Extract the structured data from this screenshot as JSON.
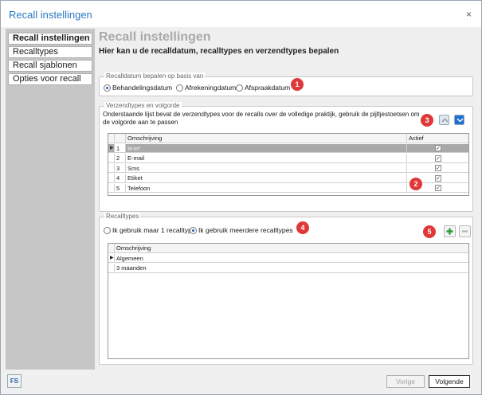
{
  "window": {
    "title": "Recall instellingen",
    "close_glyph": "×"
  },
  "sidebar": {
    "items": [
      {
        "label": "Recall instellingen"
      },
      {
        "label": "Recalltypes"
      },
      {
        "label": "Recall sjablonen"
      },
      {
        "label": "Opties voor recall"
      }
    ]
  },
  "main": {
    "heading": "Recall instellingen",
    "subheading": "Hier kan u de recalldatum, recalltypes en verzendtypes bepalen"
  },
  "recalldate": {
    "legend": "Recalldatum bepalen op basis van",
    "options": [
      "Behandelingsdatum",
      "Afrekeningdatum",
      "Afspraakdatum"
    ],
    "selected": "Behandelingsdatum"
  },
  "shipping": {
    "legend": "Verzendtypes en volgorde",
    "description": "Onderstaande lijst bevat de verzendtypes voor de recalls over de volledige praktijk, gebruik de pijltjestoetsen om de volgorde aan te passen",
    "columns": {
      "description": "Omschrijving",
      "active": "Actief"
    },
    "rows": [
      {
        "num": "1",
        "label": "Brief",
        "active": true
      },
      {
        "num": "2",
        "label": "E-mail",
        "active": true
      },
      {
        "num": "3",
        "label": "Sms",
        "active": true
      },
      {
        "num": "4",
        "label": "Etiket",
        "active": true
      },
      {
        "num": "5",
        "label": "Telefoon",
        "active": true
      }
    ]
  },
  "recalltypes": {
    "legend": "Recalltypes",
    "options": [
      "Ik gebruik maar 1 recalltype",
      "Ik gebruik meerdere recalltypes"
    ],
    "selected": "Ik gebruik meerdere recalltypes",
    "column": "Omschrijving",
    "rows": [
      "Algemeen",
      "3 maanden"
    ]
  },
  "badges": [
    "1",
    "2",
    "3",
    "4",
    "5"
  ],
  "footer": {
    "logo": "FS",
    "previous": "Vorige",
    "next": "Volgende"
  },
  "colors": {
    "title": "#2b79c2",
    "badge": "#e03838",
    "sidebar": "#c6c6c6",
    "selected_row": "#a9a9a9",
    "add": "#2e9a3a",
    "arrow_down": "#1f6fd1"
  },
  "icons": {
    "close": "close-icon",
    "up": "arrow-up-icon",
    "down": "arrow-down-icon",
    "add": "plus-icon",
    "remove": "minus-icon",
    "check": "checkmark-icon",
    "row_pointer": "row-pointer-icon"
  }
}
